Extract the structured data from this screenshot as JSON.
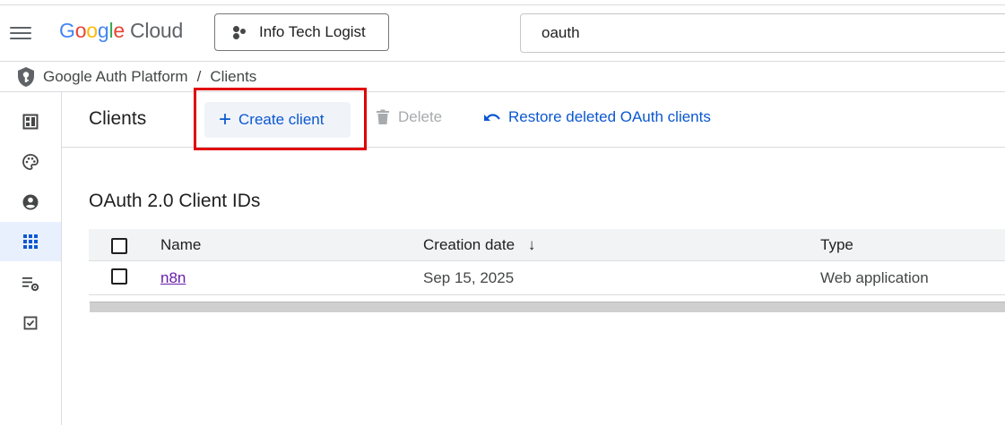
{
  "header": {
    "logo_google": [
      "G",
      "o",
      "o",
      "g",
      "l",
      "e"
    ],
    "logo_product": "Cloud",
    "project_name": "Info Tech Logist",
    "search_value": "oauth"
  },
  "breadcrumb": {
    "parent": "Google Auth Platform",
    "separator": "/",
    "current": "Clients"
  },
  "rail": {
    "items": [
      {
        "icon": "dashboard-icon",
        "active": false
      },
      {
        "icon": "palette-icon",
        "active": false
      },
      {
        "icon": "account-circle-icon",
        "active": false
      },
      {
        "icon": "apps-grid-icon",
        "active": true
      },
      {
        "icon": "list-settings-icon",
        "active": false
      },
      {
        "icon": "checkbox-icon",
        "active": false
      }
    ]
  },
  "toolbar": {
    "title": "Clients",
    "create_label": "Create client",
    "delete_label": "Delete",
    "restore_label": "Restore deleted OAuth clients"
  },
  "section": {
    "title": "OAuth 2.0 Client IDs"
  },
  "table": {
    "columns": {
      "name": "Name",
      "creation_date": "Creation date",
      "type": "Type"
    },
    "sort_indicator": "↓",
    "rows": [
      {
        "name": "n8n",
        "creation_date": "Sep 15, 2025",
        "type": "Web application"
      }
    ]
  },
  "colors": {
    "accent": "#0b57d0",
    "highlight_box": "#e00000",
    "link_visited": "#681da8"
  }
}
